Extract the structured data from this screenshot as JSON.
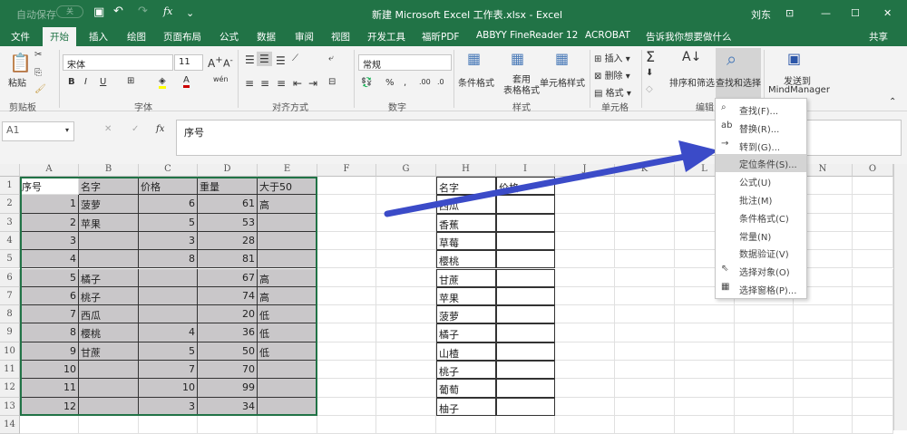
{
  "title": {
    "autosave": "自动保存",
    "autosave_state": "关",
    "doc": "新建 Microsoft Excel 工作表.xlsx - Excel",
    "user": "刘东"
  },
  "tabs": [
    "文件",
    "开始",
    "插入",
    "绘图",
    "页面布局",
    "公式",
    "数据",
    "审阅",
    "视图",
    "开发工具",
    "福昕PDF",
    "ABBYY FineReader 12",
    "ACROBAT"
  ],
  "tell_me": "告诉我你想要做什么",
  "share": "共享",
  "ribbon": {
    "paste": "粘贴",
    "font": "宋体",
    "size": "11",
    "number_format": "常规",
    "cond_format": "条件格式",
    "table_format": "套用\n表格格式",
    "cell_style": "单元格样式",
    "insert": "插入",
    "delete": "删除",
    "format": "格式",
    "sort": "排序和筛选",
    "find": "查找和选择",
    "send_to": "发送到",
    "mindmanager": "MindManager",
    "groups": [
      "剪贴板",
      "字体",
      "对齐方式",
      "数字",
      "样式",
      "单元格",
      "编辑"
    ]
  },
  "formula_bar": {
    "name_box": "A1",
    "fx": "fx",
    "content": "序号"
  },
  "columns": [
    "A",
    "B",
    "C",
    "D",
    "E",
    "F",
    "G",
    "H",
    "I",
    "J",
    "K",
    "L",
    "M",
    "N",
    "O"
  ],
  "rows": [
    [
      "序号",
      "名字",
      "价格",
      "重量",
      "大于50",
      "",
      "",
      "名字",
      "价格"
    ],
    [
      "1",
      "菠萝",
      "6",
      "61",
      "高",
      "",
      "",
      "西瓜",
      ""
    ],
    [
      "2",
      "苹果",
      "5",
      "53",
      "",
      "",
      "",
      "香蕉",
      ""
    ],
    [
      "3",
      "",
      "3",
      "28",
      "",
      "",
      "",
      "草莓",
      ""
    ],
    [
      "4",
      "",
      "8",
      "81",
      "",
      "",
      "",
      "樱桃",
      ""
    ],
    [
      "5",
      "橘子",
      "",
      "67",
      "高",
      "",
      "",
      "甘蔗",
      ""
    ],
    [
      "6",
      "桃子",
      "",
      "74",
      "高",
      "",
      "",
      "苹果",
      ""
    ],
    [
      "7",
      "西瓜",
      "",
      "20",
      "低",
      "",
      "",
      "菠萝",
      ""
    ],
    [
      "8",
      "樱桃",
      "4",
      "36",
      "低",
      "",
      "",
      "橘子",
      ""
    ],
    [
      "9",
      "甘蔗",
      "5",
      "50",
      "低",
      "",
      "",
      "山楂",
      ""
    ],
    [
      "10",
      "",
      "7",
      "70",
      "",
      "",
      "",
      "桃子",
      ""
    ],
    [
      "11",
      "",
      "10",
      "99",
      "",
      "",
      "",
      "葡萄",
      ""
    ],
    [
      "12",
      "",
      "3",
      "34",
      "",
      "",
      "",
      "柚子",
      ""
    ],
    [
      "",
      "",
      "",
      "",
      "",
      "",
      "",
      "",
      ""
    ]
  ],
  "menu": [
    {
      "icon": "⌕",
      "label": "查找(F)..."
    },
    {
      "icon": "ab",
      "label": "替换(R)..."
    },
    {
      "icon": "→",
      "label": "转到(G)..."
    },
    {
      "icon": "",
      "label": "定位条件(S)...",
      "highlight": true
    },
    {
      "icon": "",
      "label": "公式(U)"
    },
    {
      "icon": "",
      "label": "批注(M)"
    },
    {
      "icon": "",
      "label": "条件格式(C)"
    },
    {
      "icon": "",
      "label": "常量(N)"
    },
    {
      "icon": "",
      "label": "数据验证(V)"
    },
    {
      "icon": "⇖",
      "label": "选择对象(O)"
    },
    {
      "icon": "▦",
      "label": "选择窗格(P)..."
    }
  ],
  "colors": {
    "brand": "#217346",
    "selection": "#c9c7c9",
    "arrow": "#3b4bc8"
  }
}
